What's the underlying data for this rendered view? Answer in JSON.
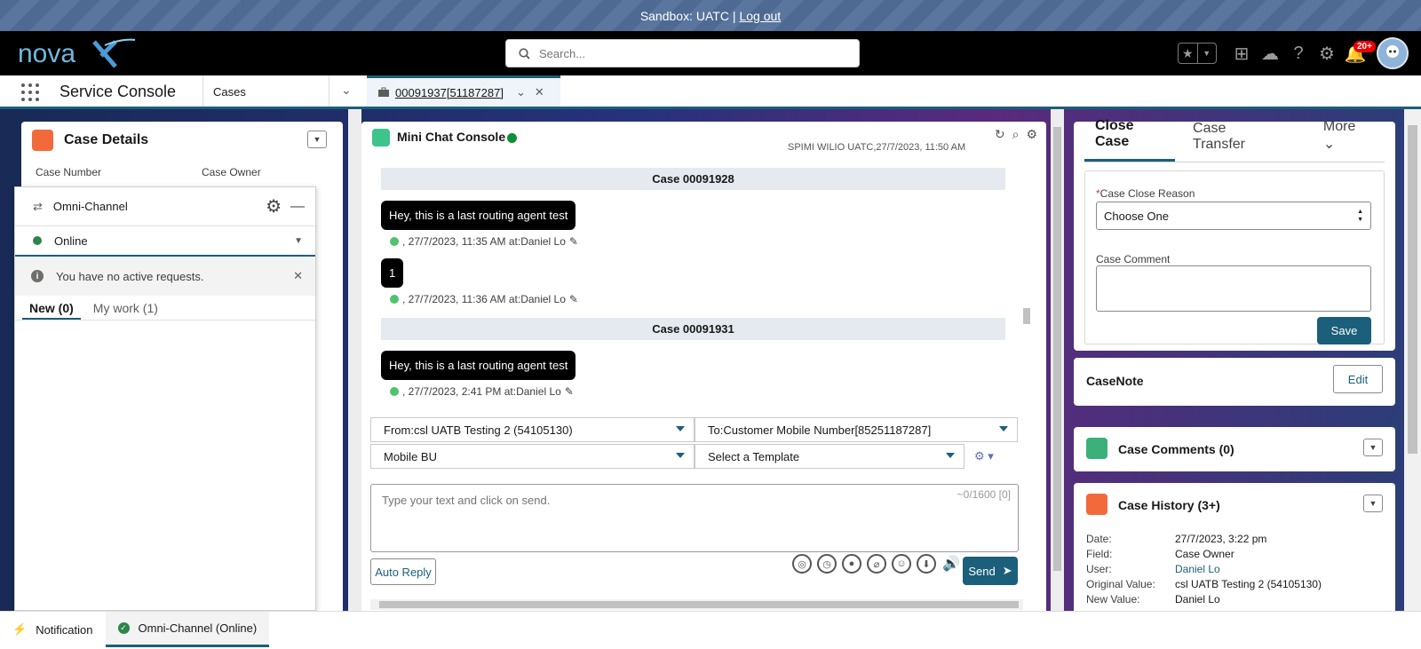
{
  "sandbox": {
    "text": "Sandbox: UATC |",
    "logout": "Log out"
  },
  "header": {
    "logo": "novaX",
    "search_placeholder": "Search...",
    "notification_count": "20+"
  },
  "nav": {
    "app_name": "Service Console",
    "object": "Cases",
    "tab_label": "00091937[51187287]"
  },
  "case_details": {
    "title": "Case Details",
    "case_number_label": "Case Number",
    "case_owner_label": "Case Owner"
  },
  "omni": {
    "title": "Omni-Channel",
    "status": "Online",
    "notice": "You have no active requests.",
    "tabs": [
      "New (0)",
      "My work (1)"
    ]
  },
  "chat": {
    "title": "Mini Chat Console",
    "truncated_top": "SPIMI WILIO UATC,27/7/2023, 11:50 AM",
    "groups": [
      {
        "case": "Case 00091928",
        "messages": [
          {
            "text": "Hey, this is a last routing agent test",
            "meta": ", 27/7/2023, 11:35 AM at:Daniel Lo"
          },
          {
            "text": "1",
            "meta": ", 27/7/2023, 11:36 AM at:Daniel Lo"
          }
        ]
      },
      {
        "case": "Case 00091931",
        "messages": [
          {
            "text": "Hey, this is a last routing agent test",
            "meta": ", 27/7/2023, 2:41 PM at:Daniel Lo"
          }
        ]
      }
    ],
    "from": "From:csl UATB Testing 2 (54105130)",
    "to": "To:Customer Mobile Number[85251187287]",
    "bu": "Mobile BU",
    "template": "Select a Template",
    "input_placeholder": "Type your text and click on send.",
    "counter": "~0/1600 [0]",
    "auto_reply": "Auto Reply",
    "send": "Send"
  },
  "close_case": {
    "tabs": [
      "Close Case",
      "Case Transfer",
      "More"
    ],
    "reason_label": "Case Close Reason",
    "reason_value": "Choose One",
    "comment_label": "Case Comment",
    "save": "Save"
  },
  "casenote": {
    "title": "CaseNote",
    "edit": "Edit"
  },
  "case_comments": {
    "title": "Case Comments (0)"
  },
  "case_history": {
    "title": "Case History (3+)",
    "rows": [
      {
        "k": "Date:",
        "v": "27/7/2023, 3:22 pm"
      },
      {
        "k": "Field:",
        "v": "Case Owner"
      },
      {
        "k": "User:",
        "v": "Daniel Lo"
      },
      {
        "k": "Original Value:",
        "v": "csl UATB Testing 2 (54105130)"
      },
      {
        "k": "New Value:",
        "v": "Daniel Lo"
      }
    ]
  },
  "footer": {
    "notification": "Notification",
    "omni": "Omni-Channel (Online)"
  },
  "colors": {
    "brand": "#1b5f7a",
    "online": "#2e844a",
    "orange": "#f26a3b"
  }
}
